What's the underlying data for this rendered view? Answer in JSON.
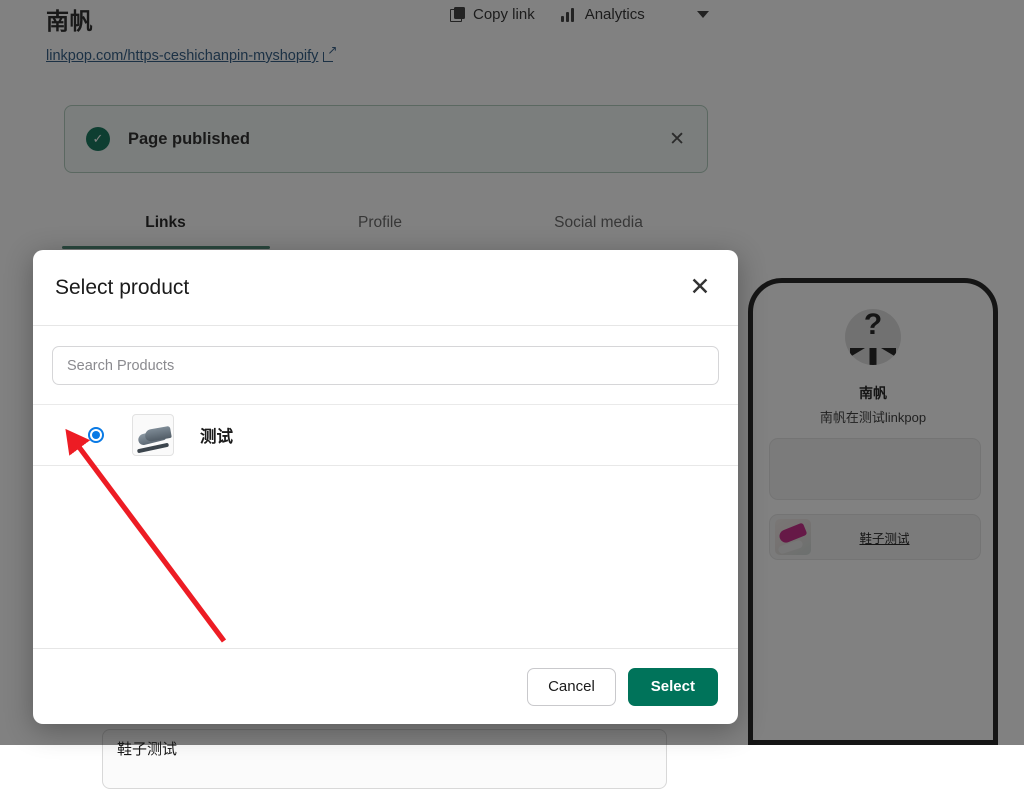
{
  "topbar": {
    "shop_title": "南帆",
    "copy_link_label": "Copy link",
    "analytics_label": "Analytics",
    "copy_icon": "copy-icon",
    "analytics_icon": "bar-chart-icon",
    "more_icon": "chevron-down-icon"
  },
  "shop_url": {
    "text": "linkpop.com/https-ceshichanpin-myshopify",
    "external_icon": "external-link-icon"
  },
  "banner": {
    "message": "Page published",
    "check_icon": "check-circle-icon",
    "close_icon": "close-icon",
    "accent_color": "#006b4f"
  },
  "tabs": [
    {
      "label": "Links",
      "active": true
    },
    {
      "label": "Profile",
      "active": false
    },
    {
      "label": "Social media",
      "active": false
    }
  ],
  "page_card": {
    "hidden_item_label": "鞋子测试"
  },
  "modal": {
    "title": "Select product",
    "close_icon": "close-icon",
    "search": {
      "placeholder": "Search Products",
      "value": ""
    },
    "products": [
      {
        "name": "测试",
        "selected": true,
        "thumb_icon": "sneaker-thumbnail"
      }
    ],
    "cancel_label": "Cancel",
    "select_label": "Select",
    "select_color": "#00735a"
  },
  "phone_preview": {
    "avatar_icon": "question-mark-avatar",
    "name": "南帆",
    "bio": "南帆在测试linkpop",
    "cards": [
      {
        "type": "empty",
        "label": ""
      },
      {
        "type": "product",
        "label": "鞋子测试",
        "thumb_icon": "pink-shoe-thumbnail"
      }
    ]
  },
  "annotation": {
    "arrow_color": "#ed1c24",
    "points_to": "product-radio-button"
  }
}
